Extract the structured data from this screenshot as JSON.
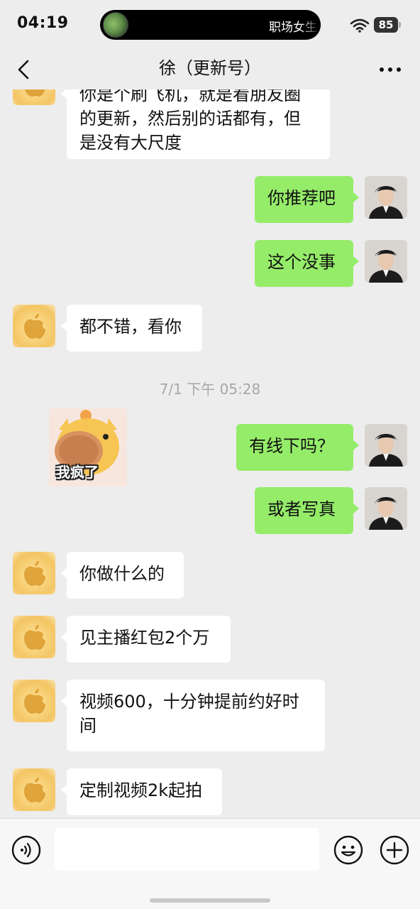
{
  "status_bar": {
    "time": "04:19",
    "island_text": "职场女生",
    "battery_level": "85"
  },
  "header": {
    "title": "徐（更新号）"
  },
  "messages": [
    {
      "sender": "contact",
      "text": "你是个刷飞机，就是看朋友圈的更新，然后别的话都有，但是没有大尺度",
      "partially_visible": true
    },
    {
      "sender": "me",
      "text": "你推荐吧"
    },
    {
      "sender": "me",
      "text": "这个没事"
    },
    {
      "sender": "contact",
      "text": "都不错，看你"
    },
    {
      "type": "timestamp",
      "text": "7/1 下午 05:28"
    },
    {
      "sender": "contact",
      "type": "sticker",
      "caption": "我疯了"
    },
    {
      "sender": "me",
      "text": "有线下吗？"
    },
    {
      "sender": "me",
      "text": "或者写真"
    },
    {
      "sender": "contact",
      "text": "你做什么的"
    },
    {
      "sender": "contact",
      "text": "见主播红包2个万"
    },
    {
      "sender": "contact",
      "text": "视频600，十分钟提前约好时间"
    },
    {
      "sender": "contact",
      "text": "定制视频2k起拍"
    }
  ],
  "input": {
    "value": "",
    "placeholder": ""
  },
  "icons": {
    "back": "chevron-left-icon",
    "more": "more-dots-icon",
    "voice": "voice-icon",
    "emoji": "emoji-icon",
    "plus": "plus-icon",
    "wifi": "wifi-icon"
  },
  "colors": {
    "background": "#ededed",
    "outgoing_bubble": "#95ec69",
    "incoming_bubble": "#ffffff",
    "timestamp_text": "#a8a8a8"
  }
}
